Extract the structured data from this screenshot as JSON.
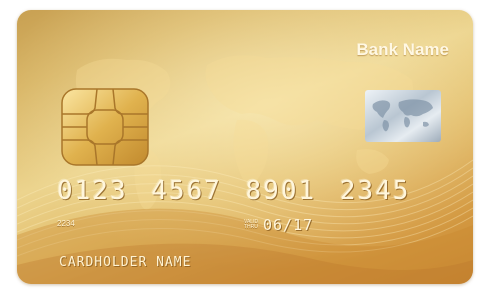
{
  "card": {
    "bank_name": "Bank Name",
    "number": "0123 4567 8901 2345",
    "small_number": "2234",
    "valid_thru_label": "VALID THRU",
    "expiry": "06/17",
    "cardholder_name": "CARDHOLDER NAME"
  },
  "colors": {
    "card_gold": "#e2bd6a",
    "card_dark_gold": "#c98a35",
    "text_cream": "#fff6dc",
    "hologram_silver": "#c8d3dc"
  },
  "icons": {
    "chip": "emv-chip-icon",
    "hologram": "hologram-world-map-icon"
  }
}
